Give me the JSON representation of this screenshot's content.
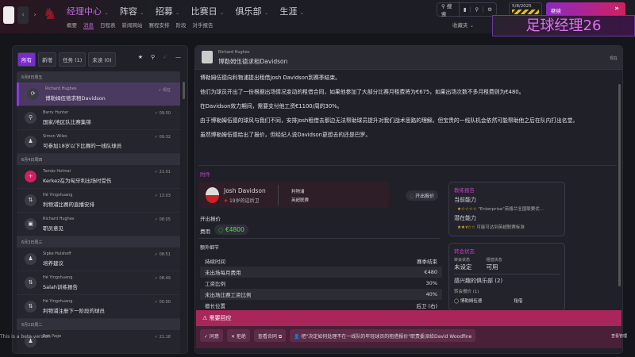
{
  "topbar": {
    "main_nav": [
      "经理中心",
      "阵容",
      "招募",
      "比赛日",
      "俱乐部",
      "生涯"
    ],
    "sub_nav": [
      "概要",
      "消息",
      "日程表",
      "新闻网站",
      "赛程安排",
      "阶段",
      "对手报告"
    ],
    "search_label": "搜索",
    "date": "5/8/2025",
    "continue_label": "继续",
    "favorites_label": "收藏夹",
    "watermark": "足球经理26"
  },
  "inbox": {
    "tabs": [
      "所有",
      "新增",
      "任务 (1)",
      "未读 (0)"
    ],
    "groups": [
      {
        "date": "6月8日周五",
        "items": [
          {
            "sender": "Richard Hughes",
            "subject": "博勒姆伍德求租Davidson",
            "time": "现在",
            "icon": "refresh-icon"
          },
          {
            "sender": "Barry Hunter",
            "subject": "国家/地区队比赛集锦",
            "time": "09:50",
            "icon": "search-icon"
          },
          {
            "sender": "Simon Wiles",
            "subject": "可参加18岁以下比赛的一线队球员",
            "time": "09:32",
            "icon": "group-icon"
          }
        ]
      },
      {
        "date": "6月4日周四",
        "items": [
          {
            "sender": "Tamás Holmal",
            "subject": "Kerkez在为匈牙利出场时受伤",
            "time": "21:01",
            "icon": "medical-icon"
          },
          {
            "sender": "Hé Yingshuang",
            "subject": "利物浦比赛的直播安排",
            "time": "13:03",
            "icon": "transfer-icon"
          },
          {
            "sender": "Richard Hughes",
            "subject": "职员意见",
            "time": "08:05",
            "icon": "briefcase-icon"
          }
        ]
      },
      {
        "date": "6月3日周三",
        "items": [
          {
            "sender": "Sipke Hulshoff",
            "subject": "培养建议",
            "time": "08:51",
            "icon": "group-icon"
          },
          {
            "sender": "Hé Yingshuang",
            "subject": "Salah训练报告",
            "time": "08:49",
            "icon": "transfer-icon"
          },
          {
            "sender": "Hé Yingshuang",
            "subject": "利物浦注册下一阶段的球员",
            "time": "00:00",
            "icon": "transfer-icon"
          }
        ]
      },
      {
        "date": "6月2日周二",
        "items": [
          {
            "sender": "Rob Page",
            "subject": "",
            "time": "21:18",
            "icon": "group-icon"
          }
        ]
      }
    ]
  },
  "message": {
    "sender": "Richard Hughes",
    "title": "博勒姆伍德求租Davidson",
    "time": "现在",
    "paragraphs": [
      "博勒姆伍德向利物浦提出租借Josh Davidson到赛季结束。",
      "他们为球员开出了一份根据出场情况变动的租借合同，如果他参加了大部分比赛月租费将为€675，如果出场次数不多月租费则为€480。",
      "在Davidson效力期间，需要支付他工资€1100/周的30%。",
      "由于博勒姆伍德的球风与我们不同，安排Josh租借去那边无法帮助球员提升对我们战术思路的理解。但宝贵的一线队机会依然可能帮助他之后在队内打出名堂。",
      "虽然博勒姆伍德给出了报价，但经纪人说Davidson更想去的还是巴罗。"
    ],
    "attachment_label": "附件",
    "player": {
      "name": "Josh Davidson",
      "desc": "19岁的边后卫",
      "club": "利物浦",
      "league": "英超联赛",
      "offer_button": "开出报价"
    },
    "offer_label": "开出报价",
    "fee_label": "费用",
    "fee": "€4800",
    "extra_title": "额外细节",
    "details": [
      {
        "k": "持续时间",
        "v": "赛季结束"
      },
      {
        "k": "未出场每月费用",
        "v": "€480"
      },
      {
        "k": "工资比例",
        "v": "30%"
      },
      {
        "k": "未出场比赛工资比例",
        "v": "40%"
      },
      {
        "k": "擅长位置",
        "v": "后卫 (右)"
      }
    ],
    "report": {
      "title": "教练报告",
      "ca_label": "当前能力",
      "ca_stars": 1,
      "ca_text": "\"Enterprise\"英格兰全国联赛优...",
      "pa_label": "潜在能力",
      "pa_stars": 2.5,
      "pa_text": "可能可达到英超联赛标准"
    },
    "transfer": {
      "title": "转会状态",
      "status_label": "转会状态",
      "status": "未设定",
      "loan_label": "租借状态",
      "loan": "可用",
      "interest": "感兴趣的俱乐部 (2)",
      "offers": "转会报价 (1)",
      "offer_club": "博勒姆伍德",
      "offer_type": "租借"
    },
    "alert": "需要回应",
    "actions": [
      "同意",
      "拒绝",
      "查看合同",
      "把\"决定如何处理不在一线队的年轻球员的租借报价\"职责委派给David Woodfine"
    ]
  },
  "footer": {
    "beta": "This is a beta version",
    "corner": "查看管理"
  }
}
